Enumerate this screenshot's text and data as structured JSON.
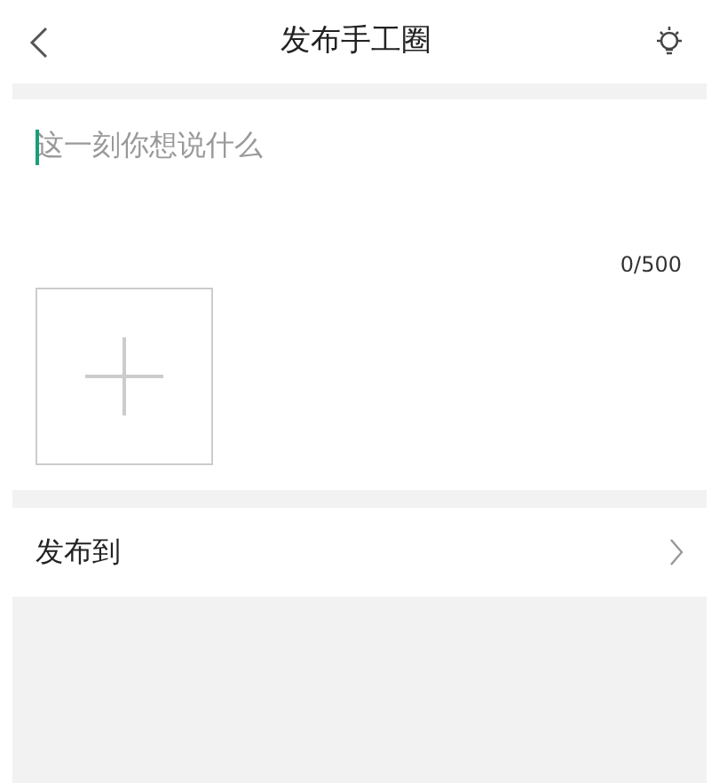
{
  "header": {
    "title": "发布手工圈"
  },
  "post": {
    "placeholder": "这一刻你想说什么",
    "counter": "0/500"
  },
  "publish_to": {
    "label": "发布到"
  }
}
